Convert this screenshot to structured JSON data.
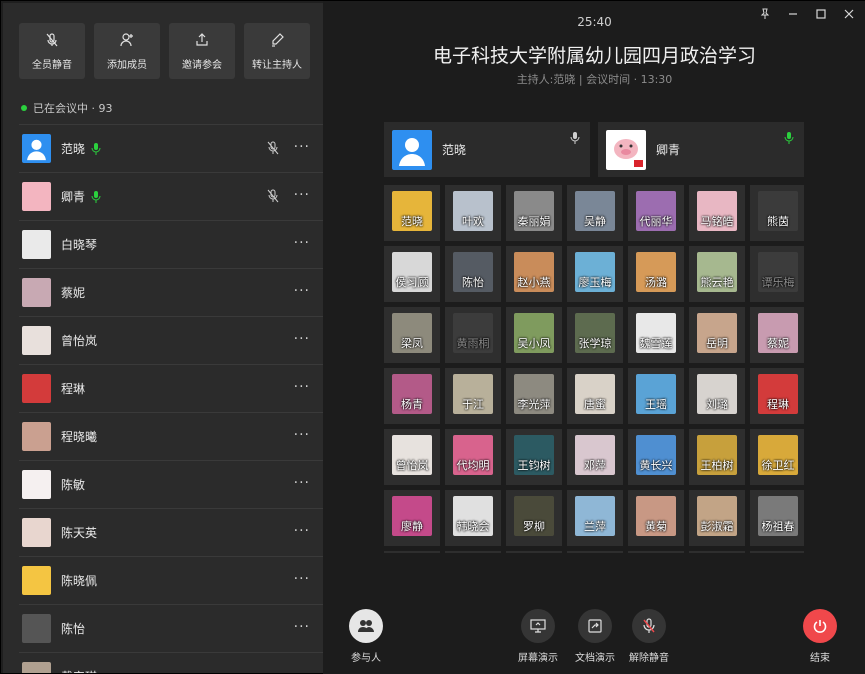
{
  "sidebar": {
    "actions": [
      {
        "label": "全员静音",
        "icon": "mic-off-icon"
      },
      {
        "label": "添加成员",
        "icon": "add-user-icon"
      },
      {
        "label": "邀请参会",
        "icon": "share-icon"
      },
      {
        "label": "转让主持人",
        "icon": "pen-icon"
      }
    ],
    "status": "已在会议中 · 93",
    "members": [
      {
        "name": "范晓",
        "speaking": true,
        "muted_icon": true,
        "avatar": "default"
      },
      {
        "name": "卿青",
        "speaking": true,
        "muted_icon": true,
        "avatar": "pig"
      },
      {
        "name": "白晓琴",
        "avatar": "cartoon"
      },
      {
        "name": "蔡妮",
        "avatar": "photo"
      },
      {
        "name": "曾怡岚",
        "avatar": "girl"
      },
      {
        "name": "程琳",
        "avatar": "red-poster"
      },
      {
        "name": "程晓曦",
        "avatar": "child"
      },
      {
        "name": "陈敏",
        "avatar": "heart"
      },
      {
        "name": "陈天英",
        "avatar": "girl2"
      },
      {
        "name": "陈晓佩",
        "avatar": "sun"
      },
      {
        "name": "陈怡",
        "avatar": "car"
      },
      {
        "name": "戴安琪",
        "avatar": "photo2"
      }
    ]
  },
  "header": {
    "timer": "25:40",
    "title": "电子科技大学附属幼儿园四月政治学习",
    "subtitle": "主持人:范晓 | 会议时间 · 13:30"
  },
  "speakers": [
    {
      "name": "范晓"
    },
    {
      "name": "卿青"
    }
  ],
  "grid": [
    {
      "name": "范晓",
      "color": "#e6b53a"
    },
    {
      "name": "叶欢",
      "color": "#b8c1cc"
    },
    {
      "name": "秦丽娟",
      "color": "#8a8a8a"
    },
    {
      "name": "吴静",
      "color": "#7a8797"
    },
    {
      "name": "代丽华",
      "color": "#9c6db0"
    },
    {
      "name": "马铭皓",
      "color": "#e8b7c3"
    },
    {
      "name": "熊茵",
      "color": "#3b3b3b"
    },
    {
      "name": "侯习顾",
      "color": "#d8d8d8"
    },
    {
      "name": "陈怡",
      "color": "#555b63"
    },
    {
      "name": "赵小燕",
      "color": "#c98c5a"
    },
    {
      "name": "廖玉梅",
      "color": "#6cb0d6"
    },
    {
      "name": "汤潞",
      "color": "#d69a58"
    },
    {
      "name": "熊云艳",
      "color": "#a6b88f"
    },
    {
      "name": "谭乐梅",
      "color": "#555555",
      "dim": true
    },
    {
      "name": "梁凤",
      "color": "#8d8a7c"
    },
    {
      "name": "黄雨桐",
      "color": "#555555",
      "dim": true
    },
    {
      "name": "吴小凤",
      "color": "#7f9b5e"
    },
    {
      "name": "张学琼",
      "color": "#5d6b4f"
    },
    {
      "name": "魏雪莲",
      "color": "#e8e8e8"
    },
    {
      "name": "岳明",
      "color": "#c7a58c"
    },
    {
      "name": "蔡妮",
      "color": "#c89bb0"
    },
    {
      "name": "杨青",
      "color": "#b35a88"
    },
    {
      "name": "于江",
      "color": "#b8b09a"
    },
    {
      "name": "李光萍",
      "color": "#8d8a80"
    },
    {
      "name": "唐蜜",
      "color": "#d9d2c8"
    },
    {
      "name": "王瑶",
      "color": "#5aa3d6"
    },
    {
      "name": "刘璐",
      "color": "#d7d3cf"
    },
    {
      "name": "程琳",
      "color": "#d33b3b"
    },
    {
      "name": "曾怡岚",
      "color": "#e7e2de"
    },
    {
      "name": "代均明",
      "color": "#d8638d"
    },
    {
      "name": "王钧树",
      "color": "#2c5a62"
    },
    {
      "name": "邓萍",
      "color": "#d9c7cf"
    },
    {
      "name": "黄长兴",
      "color": "#4f8fd1"
    },
    {
      "name": "王柏树",
      "color": "#c7a03c"
    },
    {
      "name": "徐卫红",
      "color": "#d8a93a"
    },
    {
      "name": "廖静",
      "color": "#c44a8a"
    },
    {
      "name": "韩晓会",
      "color": "#e0e0e0"
    },
    {
      "name": "罗柳",
      "color": "#4a4a3a"
    },
    {
      "name": "兰萍",
      "color": "#8fb7d6"
    },
    {
      "name": "黄菊",
      "color": "#c89884"
    },
    {
      "name": "彭淑霜",
      "color": "#c2a486"
    },
    {
      "name": "杨祖春",
      "color": "#7a7a7a"
    },
    {
      "name": "",
      "color": "#6a6a6a"
    },
    {
      "name": "",
      "color": "#6a6a6a"
    },
    {
      "name": "",
      "color": "#6a6a6a"
    },
    {
      "name": "",
      "color": "#6a6a6a"
    },
    {
      "name": "",
      "color": "#6a6a6a"
    },
    {
      "name": "",
      "color": "#6a6a6a"
    },
    {
      "name": "",
      "color": "#6a6a6a"
    }
  ],
  "bottom": {
    "participants": "参与人",
    "screen_share": "屏幕演示",
    "doc_share": "文档演示",
    "unmute": "解除静音",
    "end": "结束"
  },
  "colors": {
    "accent_green": "#2bd13e",
    "end_red": "#f0484b",
    "panel": "#2b2b2b"
  }
}
